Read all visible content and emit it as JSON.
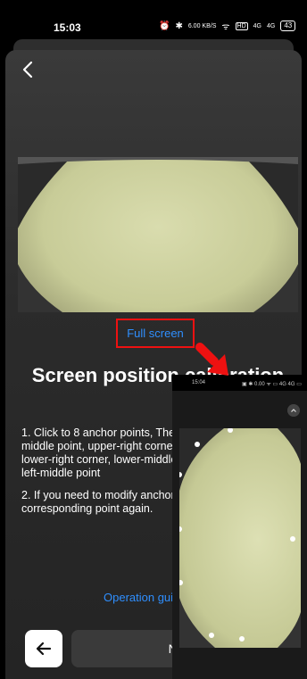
{
  "status_bar": {
    "time": "15:03",
    "net_speed": "6.00 KB/S",
    "hd_badge": "HD",
    "signal1": "4G",
    "signal2": "4G",
    "battery": "43"
  },
  "preview": {
    "fullscreen_label": "Full screen"
  },
  "page": {
    "title": "Screen position calibration"
  },
  "instructions": {
    "step1": "1. Click to 8 anchor points, The upper-left corner, upper-middle point, upper-right corner, right-middle point, lower-right corner, lower-middle point, lower-left corner, left-middle point",
    "step2": "2. If you need to modify anchor points, please click the corresponding point again."
  },
  "footer": {
    "operation_guide": "Operation guide",
    "next_label": "Next"
  },
  "inset": {
    "time": "15:04",
    "status_icons": "▣ ✱ 0.00 ᯤ ▭ 4G 4G ▭"
  },
  "colors": {
    "accent": "#2f8fff",
    "highlight": "#e11111",
    "background": "#2b2b2b"
  },
  "icons": {
    "back_chevron": "chevron-left-icon",
    "back_arrow": "arrow-left-icon",
    "collapse": "chevron-up-icon"
  }
}
